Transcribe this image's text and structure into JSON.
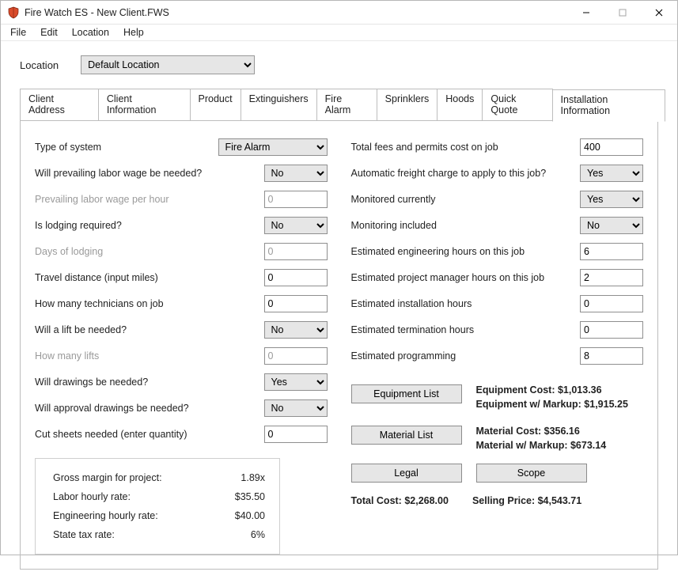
{
  "window": {
    "title": "Fire Watch ES - New Client.FWS",
    "icon": "shield-icon"
  },
  "menubar": [
    "File",
    "Edit",
    "Location",
    "Help"
  ],
  "location": {
    "label": "Location",
    "value": "Default Location"
  },
  "tabs": [
    "Client Address",
    "Client Information",
    "Product",
    "Extinguishers",
    "Fire Alarm",
    "Sprinklers",
    "Hoods",
    "Quick Quote",
    "Installation Information"
  ],
  "left": {
    "type_of_system_label": "Type of system",
    "type_of_system": "Fire Alarm",
    "prevailing_wage_label": "Will prevailing labor wage be needed?",
    "prevailing_wage": "No",
    "prevailing_wage_per_hour_label": "Prevailing labor wage per hour",
    "prevailing_wage_per_hour": "0",
    "lodging_label": "Is lodging required?",
    "lodging": "No",
    "days_lodging_label": "Days of lodging",
    "days_lodging": "0",
    "travel_label": "Travel distance (input miles)",
    "travel": "0",
    "techs_label": "How many technicians on job",
    "techs": "0",
    "lift_label": "Will a lift be needed?",
    "lift": "No",
    "how_many_lifts_label": "How many lifts",
    "how_many_lifts": "0",
    "drawings_label": "Will drawings be needed?",
    "drawings": "Yes",
    "approval_drawings_label": "Will approval drawings be needed?",
    "approval_drawings": "No",
    "cut_sheets_label": "Cut sheets needed (enter quantity)",
    "cut_sheets": "0"
  },
  "summary": {
    "gross_margin_label": "Gross margin for project:",
    "gross_margin": "1.89x",
    "labor_rate_label": "Labor hourly rate:",
    "labor_rate": "$35.50",
    "eng_rate_label": "Engineering hourly rate:",
    "eng_rate": "$40.00",
    "tax_label": "State tax rate:",
    "tax": "6%"
  },
  "right": {
    "fees_label": "Total fees and permits cost on job",
    "fees": "400",
    "freight_label": "Automatic freight charge to apply to this job?",
    "freight": "Yes",
    "monitored_label": "Monitored currently",
    "monitored": "Yes",
    "monitoring_incl_label": "Monitoring included",
    "monitoring_incl": "No",
    "eng_hours_label": "Estimated engineering hours on this job",
    "eng_hours": "6",
    "pm_hours_label": "Estimated project manager hours on this job",
    "pm_hours": "2",
    "install_hours_label": "Estimated installation hours",
    "install_hours": "0",
    "term_hours_label": "Estimated termination hours",
    "term_hours": "0",
    "prog_hours_label": "Estimated programming",
    "prog_hours": "8"
  },
  "buttons": {
    "equipment_list": "Equipment List",
    "material_list": "Material List",
    "legal": "Legal",
    "scope": "Scope"
  },
  "costs": {
    "equipment_cost": "Equipment Cost: $1,013.36",
    "equipment_markup": "Equipment w/ Markup: $1,915.25",
    "material_cost": "Material Cost: $356.16",
    "material_markup": "Material w/ Markup: $673.14",
    "total_cost": "Total Cost: $2,268.00",
    "selling_price": "Selling Price: $4,543.71"
  }
}
